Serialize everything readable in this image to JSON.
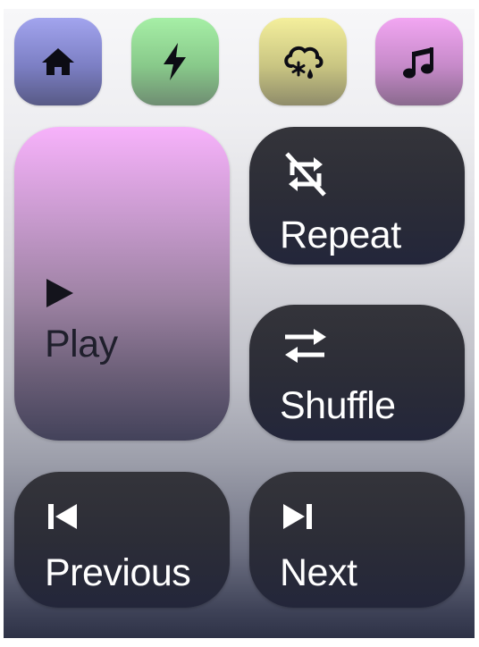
{
  "nav": {
    "items": [
      {
        "icon": "home-icon"
      },
      {
        "icon": "lightning-icon"
      },
      {
        "icon": "cloud-snow-rain-icon"
      },
      {
        "icon": "music-note-icon"
      }
    ]
  },
  "controls": {
    "play_label": "Play",
    "repeat_label": "Repeat",
    "shuffle_label": "Shuffle",
    "previous_label": "Previous",
    "next_label": "Next"
  },
  "colors": {
    "home_tile": "#7c7fc4",
    "energy_tile": "#88c98a",
    "weather_tile": "#c9c582",
    "music_tile": "#c68ac9",
    "play_card_top": "#f7b2fb",
    "dark_card": "#2c2d37"
  }
}
